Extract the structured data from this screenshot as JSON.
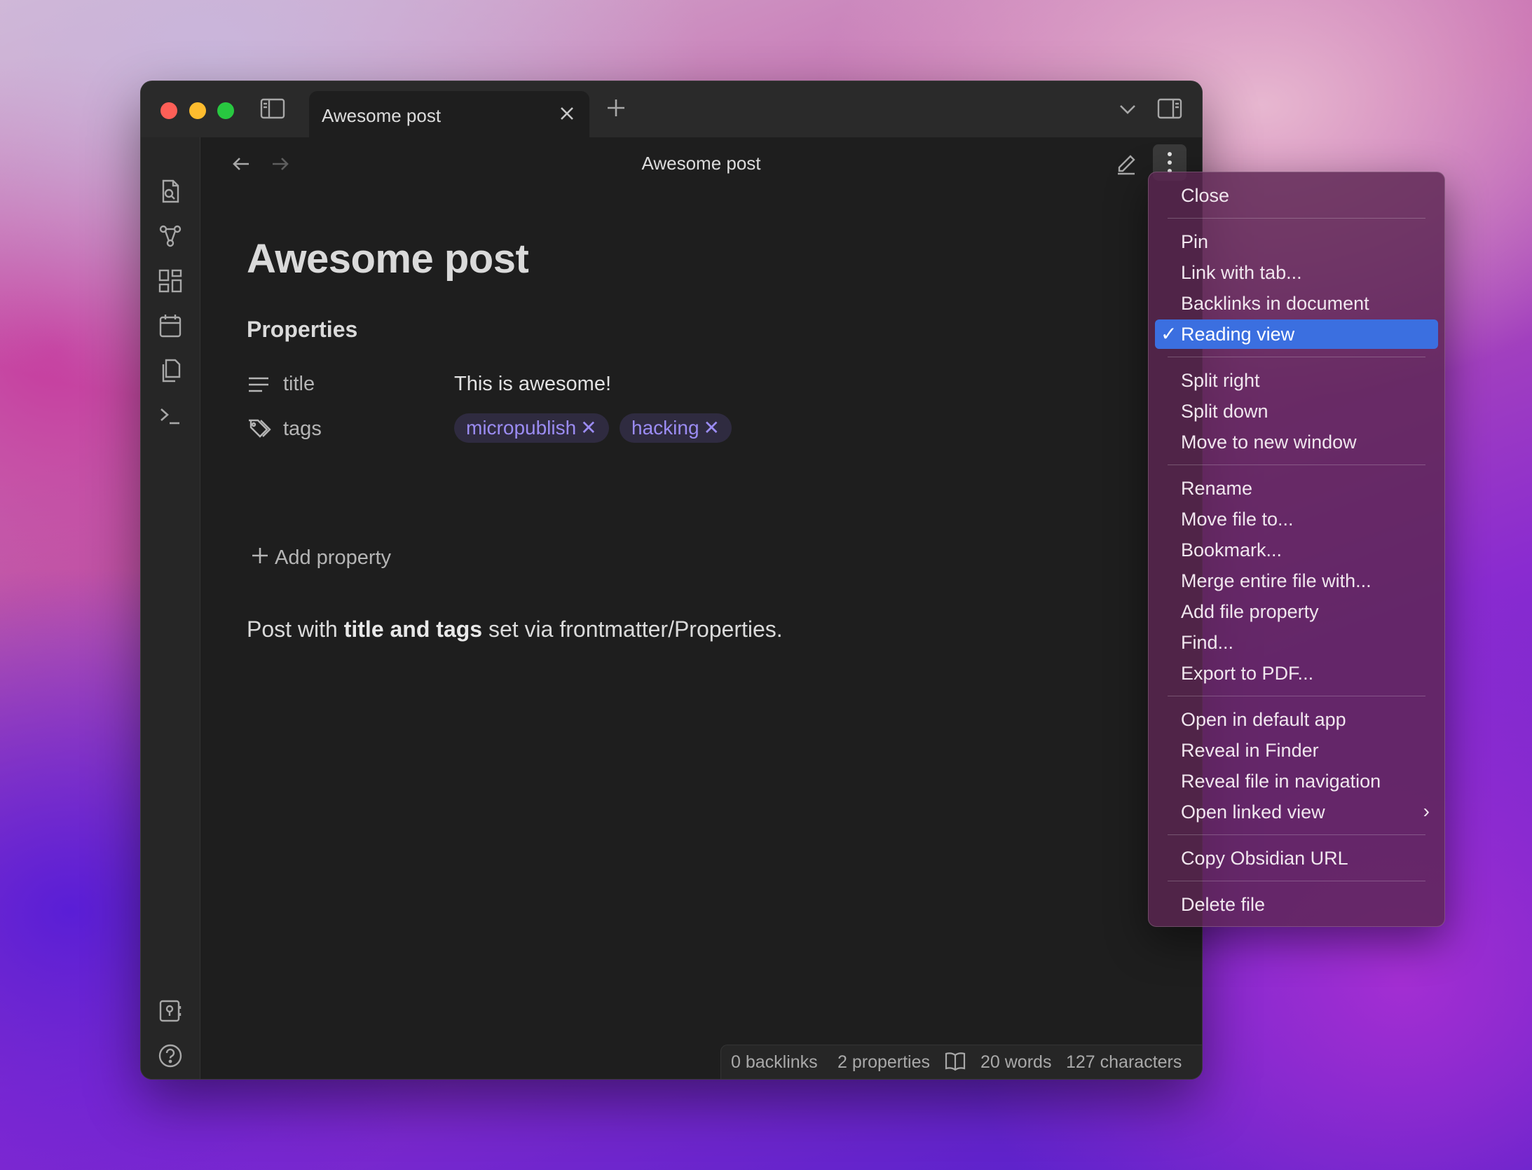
{
  "window": {
    "tab_title": "Awesome post",
    "view_title": "Awesome post"
  },
  "document": {
    "title": "Awesome post",
    "properties_heading": "Properties",
    "properties": [
      {
        "key": "title",
        "value": "This is awesome!"
      },
      {
        "key": "tags",
        "tags": [
          "micropublish",
          "hacking"
        ]
      }
    ],
    "add_property": "Add property",
    "body": {
      "before": "Post with ",
      "bold": "title and tags",
      "after": " set via frontmatter/Properties."
    }
  },
  "status": {
    "backlinks": "0 backlinks",
    "properties": "2 properties",
    "words": "20 words",
    "characters": "127 characters"
  },
  "menu": {
    "items": [
      {
        "label": "Close"
      },
      {
        "label": "Pin"
      },
      {
        "label": "Link with tab..."
      },
      {
        "label": "Backlinks in document"
      },
      {
        "label": "Reading view",
        "checked": true
      },
      {
        "label": "Split right"
      },
      {
        "label": "Split down"
      },
      {
        "label": "Move to new window"
      },
      {
        "label": "Rename"
      },
      {
        "label": "Move file to..."
      },
      {
        "label": "Bookmark..."
      },
      {
        "label": "Merge entire file with..."
      },
      {
        "label": "Add file property"
      },
      {
        "label": "Find..."
      },
      {
        "label": "Export to PDF..."
      },
      {
        "label": "Open in default app"
      },
      {
        "label": "Reveal in Finder"
      },
      {
        "label": "Reveal file in navigation"
      },
      {
        "label": "Open linked view",
        "submenu": true
      },
      {
        "label": "Copy Obsidian URL"
      },
      {
        "label": "Delete file"
      }
    ]
  },
  "icons": {
    "ribbon_top": [
      "quick-switcher-icon",
      "graph-view-icon",
      "canvas-icon",
      "daily-note-icon",
      "templates-icon",
      "command-palette-icon"
    ],
    "ribbon_bottom": [
      "vault-switcher-icon",
      "help-icon",
      "settings-icon"
    ]
  },
  "colors": {
    "accent": "#3b6fe0",
    "tag_text": "#9b8cf3"
  }
}
